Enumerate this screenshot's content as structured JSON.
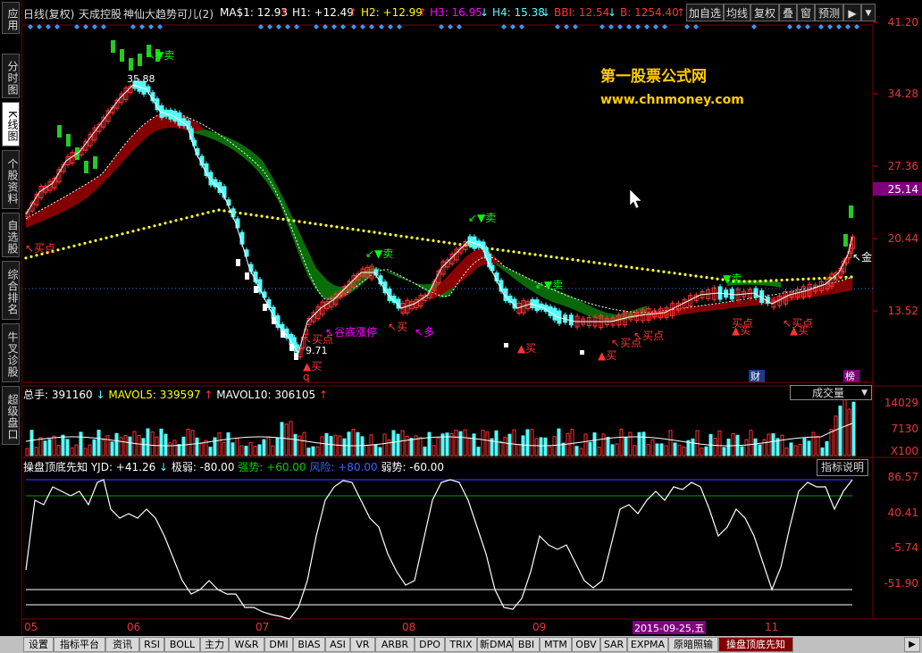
{
  "left_tabs": [
    "应用",
    "分时图",
    "K线图",
    "个股资料",
    "自选股",
    "综合排名",
    "牛叉诊股",
    "超级盘口"
  ],
  "topbar": {
    "period": "日线(复权)",
    "stock": "天成控股",
    "indicator": "神仙大趋势可儿(2)",
    "ma1": "MA$1: 12.93",
    "h1": "H1: +12.49",
    "h2": "H2: +12.99",
    "h3": "H3: 16.95",
    "h4": "H4: 15.38",
    "bbi": "BBI: 12.54",
    "b": "B: 1254.40",
    "buttons": [
      "加自选",
      "均线",
      "复权",
      "叠",
      "窗",
      "预测"
    ]
  },
  "watermark": {
    "line1": "第一股票公式网",
    "line2": "www.chnmoney.com"
  },
  "price_axis": [
    "41.20",
    "34.28",
    "27.36",
    "20.44",
    "13.52"
  ],
  "current_price_tag": "25.14",
  "chart_annotations": {
    "high": "35.88",
    "low": "9.71",
    "sell_labels": [
      "卖",
      "卖",
      "卖",
      "卖",
      "卖"
    ],
    "buy_point": "买点",
    "buy": "买",
    "valley_limit": "谷底涨停",
    "gold": "金",
    "more": "多",
    "cai": "财",
    "bang": "榜",
    "q": "q"
  },
  "volume_panel": {
    "total": "总手: 391160",
    "mavol5": "MAVOL5: 339597",
    "mavol10": "MAVOL10: 306105",
    "dropdown": "成交量",
    "axis": [
      "14029",
      "7130",
      "X100"
    ]
  },
  "indicator_panel": {
    "name": "操盘顶底先知",
    "yjd": "YJD: +41.26",
    "jiruo": "极弱: -80.00",
    "qiangshi": "强势: +60.00",
    "fengxian": "风险: +80.00",
    "ruoshi": "弱势: -60.00",
    "help": "指标说明",
    "axis": [
      "86.57",
      "40.41",
      "-5.74",
      "-51.90"
    ]
  },
  "date_axis": {
    "months": [
      "05",
      "06",
      "07",
      "08",
      "09",
      "10",
      "11"
    ],
    "cursor_date": "2015-09-25,五"
  },
  "bottom_tabs": [
    "设置",
    "指标平台",
    "资讯",
    "RSI",
    "BOLL",
    "主力",
    "W&R",
    "DMI",
    "BIAS",
    "ASI",
    "VR",
    "ARBR",
    "DPO",
    "TRIX",
    "新DMA",
    "BBI",
    "MTM",
    "OBV",
    "SAR",
    "EXPMA",
    "原暗照输",
    "操盘顶底先知"
  ],
  "colors": {
    "up": "#ff3232",
    "down": "#54fcfc",
    "green_cloud": "#0a7a0a",
    "red_cloud": "#8b0000",
    "accent": "#800080"
  }
}
